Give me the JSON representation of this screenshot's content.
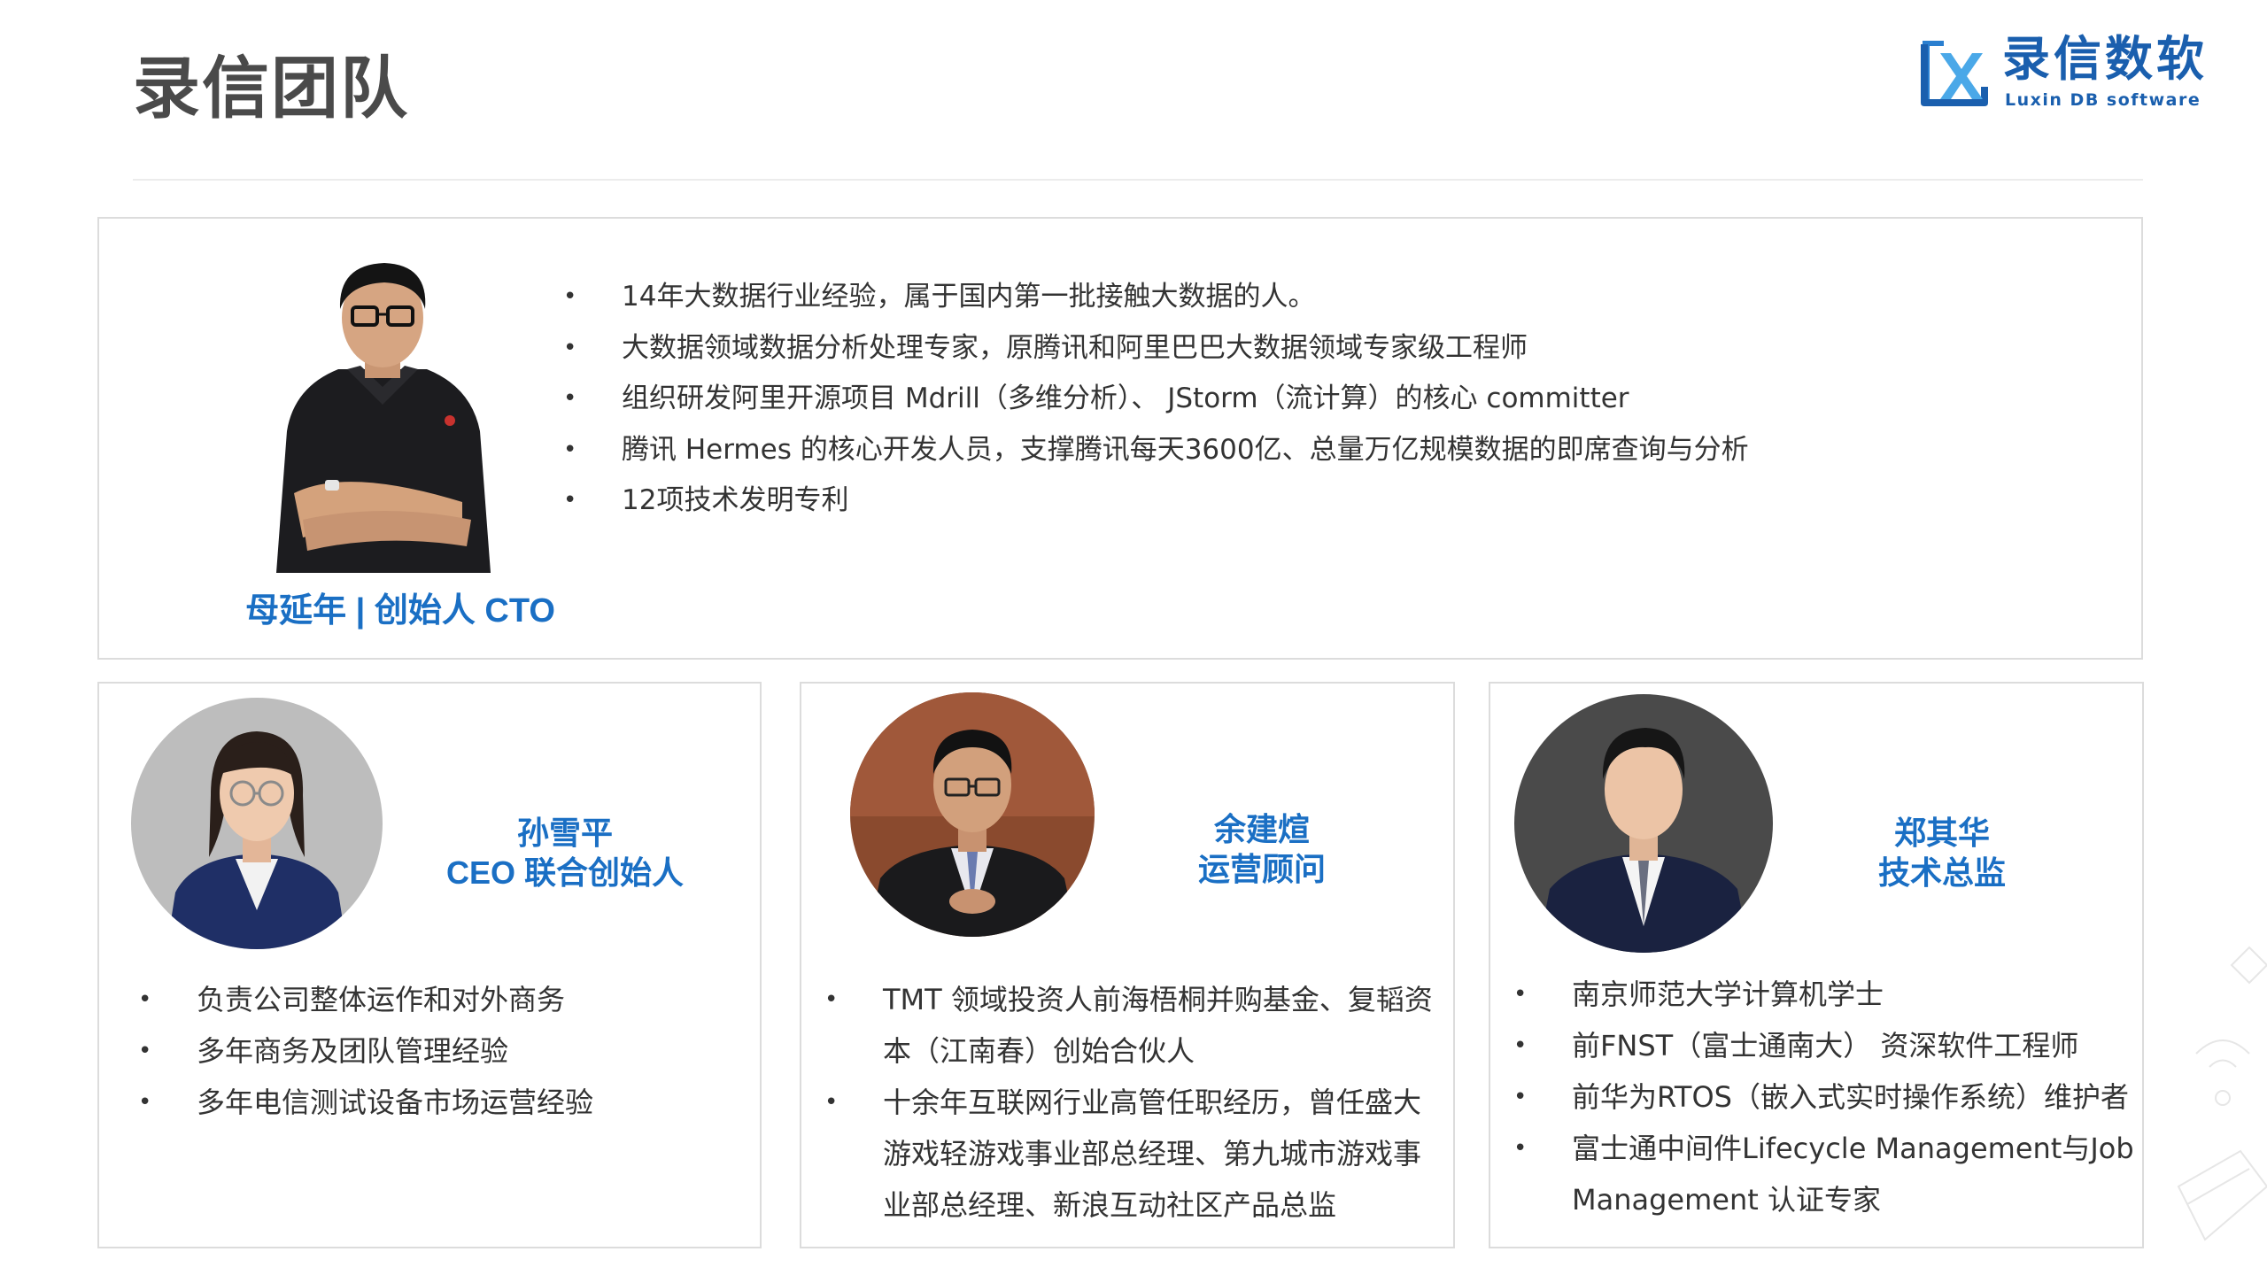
{
  "header": {
    "title": "录信团队"
  },
  "logo": {
    "mark_text": "LX",
    "name": "录信数软",
    "subtitle": "Luxin DB software"
  },
  "leader": {
    "caption": "母延年 | 创始人 CTO",
    "bullets": [
      "14年大数据行业经验，属于国内第一批接触大数据的人。",
      "大数据领域数据分析处理专家，原腾讯和阿里巴巴大数据领域专家级工程师",
      "组织研发阿里开源项目 Mdrill（多维分析）、 JStorm（流计算）的核心 committer",
      "腾讯 Hermes 的核心开发人员，支撑腾讯每天3600亿、总量万亿规模数据的即席查询与分析",
      "12项技术发明专利"
    ]
  },
  "members": [
    {
      "name": "孙雪平",
      "role": "CEO 联合创始人",
      "bullets": [
        "负责公司整体运作和对外商务",
        "多年商务及团队管理经验",
        "多年电信测试设备市场运营经验"
      ]
    },
    {
      "name": "余建煊",
      "role": "运营顾问",
      "bullets": [
        "TMT 领域投资人前海梧桐并购基金、复韬资本（江南春）创始合伙人",
        "十余年互联网行业高管任职经历，曾任盛大游戏轻游戏事业部总经理、第九城市游戏事业部总经理、新浪互动社区产品总监"
      ]
    },
    {
      "name": "郑其华",
      "role": "技术总监",
      "bullets": [
        "南京师范大学计算机学士",
        "前FNST（富士通南大） 资深软件工程师",
        "前华为RTOS（嵌入式实时操作系统）维护者",
        "富士通中间件Lifecycle Management与Job Management 认证专家"
      ]
    }
  ],
  "bullet_glyph": "•",
  "colors": {
    "accent": "#1a6fc4",
    "brand": "#1a5fae",
    "title": "#4a4a4a",
    "border": "#dcdcdc"
  }
}
